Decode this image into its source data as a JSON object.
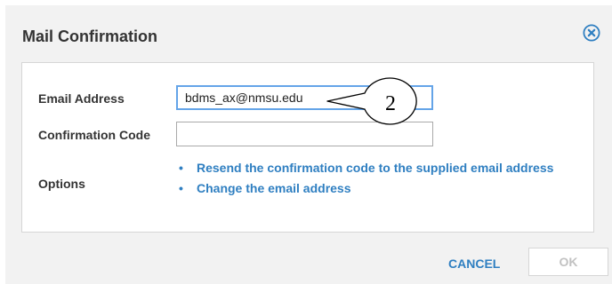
{
  "dialog": {
    "title": "Mail Confirmation",
    "close_icon": "close-circle-icon"
  },
  "form": {
    "email_label": "Email Address",
    "email_value": "bdms_ax@nmsu.edu",
    "code_label": "Confirmation Code",
    "code_value": "",
    "options_label": "Options",
    "options": [
      "Resend the confirmation code to the supplied email address",
      "Change the email address"
    ]
  },
  "annotation": {
    "callout_number": "2"
  },
  "footer": {
    "cancel_label": "CANCEL",
    "ok_label": "OK"
  },
  "colors": {
    "accent": "#2f7fc1",
    "dialog_bg": "#f2f2f2",
    "active_border": "#64a4e8"
  }
}
